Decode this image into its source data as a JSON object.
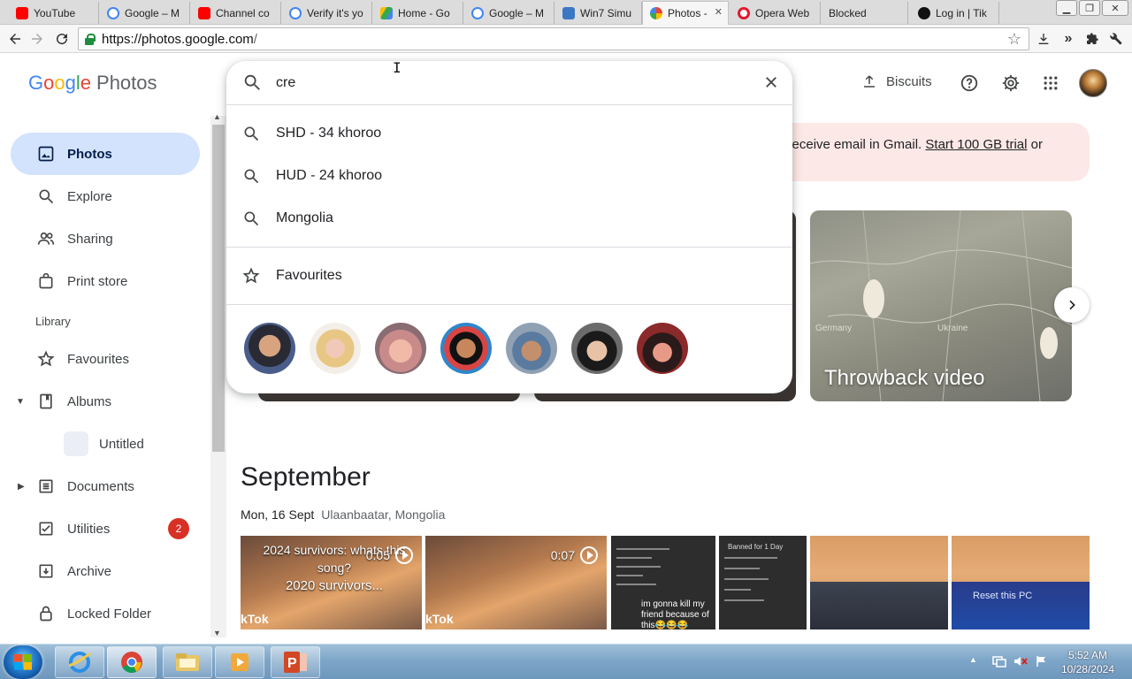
{
  "browser": {
    "tabs": [
      {
        "label": "YouTube",
        "icon": "youtube-icon"
      },
      {
        "label": "Google – M",
        "icon": "google-icon"
      },
      {
        "label": "Channel co",
        "icon": "youtube-icon"
      },
      {
        "label": "Verify it's yo",
        "icon": "google-icon"
      },
      {
        "label": "Home - Go",
        "icon": "drive-icon"
      },
      {
        "label": "Google – M",
        "icon": "google-icon"
      },
      {
        "label": "Win7 Simu",
        "icon": "win7-icon"
      },
      {
        "label": "Photos - ",
        "icon": "photos-icon"
      },
      {
        "label": "Opera Web",
        "icon": "opera-icon"
      },
      {
        "label": "Blocked",
        "icon": "blank-icon"
      },
      {
        "label": "Log in | Tik",
        "icon": "tiktok-icon"
      }
    ],
    "url_host": "https://photos.google.com",
    "url_rest": "/"
  },
  "app": {
    "logo_google": [
      "G",
      "o",
      "o",
      "g",
      "l",
      "e"
    ],
    "logo_product": "Photos",
    "upload_label": "Biscuits"
  },
  "sidebar": {
    "items": [
      {
        "label": "Photos",
        "icon": "photo-icon"
      },
      {
        "label": "Explore",
        "icon": "search-icon"
      },
      {
        "label": "Sharing",
        "icon": "people-icon"
      },
      {
        "label": "Print store",
        "icon": "bag-icon"
      }
    ],
    "library_label": "Library",
    "library_items": [
      {
        "label": "Favourites",
        "icon": "star-icon"
      },
      {
        "label": "Albums",
        "icon": "album-icon"
      },
      {
        "label": "Untitled",
        "icon": "album-thumb"
      },
      {
        "label": "Documents",
        "icon": "document-icon"
      },
      {
        "label": "Utilities",
        "icon": "checklist-icon",
        "badge": "2"
      },
      {
        "label": "Archive",
        "icon": "archive-icon"
      },
      {
        "label": "Locked Folder",
        "icon": "lock-icon"
      }
    ]
  },
  "search": {
    "value": "cre",
    "suggestions": [
      "SHD - 34 khoroo",
      "HUD - 24 khoroo",
      "Mongolia"
    ],
    "favourites_label": "Favourites",
    "face_count": 7
  },
  "promo": {
    "text_before": "d receive email in Gmail. ",
    "link": "Start 100 GB trial",
    "text_after": " or"
  },
  "memories": {
    "throwback_title": "Throwback video",
    "map_labels": [
      "Germany",
      "Ukraine"
    ]
  },
  "timeline": {
    "month": "September",
    "day": "Mon, 16 Sept",
    "location": "Ulaanbaatar, Mongolia",
    "videos": [
      {
        "caption": "2024 survivors: whats this song?",
        "caption2": "2020 survivors...",
        "duration": "0:05",
        "brand": "kTok"
      },
      {
        "caption": "",
        "caption2": "",
        "duration": "0:07",
        "brand": "kTok"
      }
    ],
    "screenshot_caption": "im gonna kill my friend because of this😂😂😂",
    "screenshot_header": "Banned for 1 Day",
    "reset_text": "Reset this PC"
  },
  "taskbar": {
    "time": "5:52 AM",
    "date": "10/28/2024"
  }
}
